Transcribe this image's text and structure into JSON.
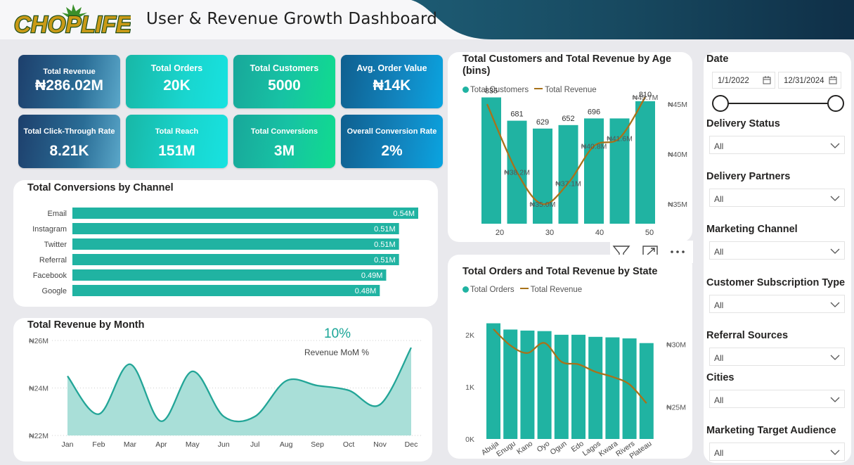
{
  "header": {
    "logo_text": "CHOPLIFE",
    "title": "User & Revenue Growth Dashboard"
  },
  "kpis": [
    {
      "label": "Total Revenue",
      "value": "₦286.02M"
    },
    {
      "label": "Total Orders",
      "value": "20K"
    },
    {
      "label": "Total Customers",
      "value": "5000"
    },
    {
      "label": "Avg. Order Value",
      "value": "₦14K"
    },
    {
      "label": "Total Click-Through Rate",
      "value": "8.21K"
    },
    {
      "label": "Total Reach",
      "value": "151M"
    },
    {
      "label": "Total Conversions",
      "value": "3M"
    },
    {
      "label": "Overall Conversion Rate",
      "value": "2%"
    }
  ],
  "colors": {
    "teal": "#20b3a2",
    "brown": "#a8721a",
    "area": "#a9dfd8",
    "area_line": "#22a597"
  },
  "chart_data": [
    {
      "type": "bar",
      "orientation": "horizontal",
      "title": "Total Conversions by Channel",
      "categories": [
        "Email",
        "Instagram",
        "Twitter",
        "Referral",
        "Facebook",
        "Google"
      ],
      "values": [
        0.54,
        0.51,
        0.51,
        0.51,
        0.49,
        0.48
      ],
      "labels": [
        "0.54M",
        "0.51M",
        "0.51M",
        "0.51M",
        "0.49M",
        "0.48M"
      ],
      "xlim": [
        0,
        0.54
      ]
    },
    {
      "type": "area",
      "title": "Total Revenue by Month",
      "x": [
        "Jan",
        "Feb",
        "Mar",
        "Apr",
        "May",
        "Jun",
        "Jul",
        "Aug",
        "Sep",
        "Oct",
        "Nov",
        "Dec"
      ],
      "values": [
        24.5,
        22.9,
        25.0,
        22.6,
        24.7,
        22.8,
        22.8,
        24.3,
        24.1,
        23.9,
        23.3,
        25.7
      ],
      "ylim": [
        22,
        26
      ],
      "yticks": [
        "₦22M",
        "₦24M",
        "₦26M"
      ],
      "annotation": {
        "value": "10%",
        "label": "Revenue MoM %"
      },
      "grid": true
    },
    {
      "type": "bar+line",
      "title": "Total Customers and Total Revenue by Age (bins)",
      "legend": [
        "Total Customers",
        "Total Revenue"
      ],
      "categories": [
        20,
        25,
        30,
        35,
        40,
        45,
        50
      ],
      "xticks": [
        "20",
        "30",
        "40",
        "50"
      ],
      "bar_values": [
        835,
        681,
        629,
        652,
        696,
        810
      ],
      "bar_labels": [
        "835",
        "681",
        "629",
        "652",
        "696",
        "",
        "810"
      ],
      "customers": [
        835,
        681,
        629,
        652,
        696,
        696,
        810
      ],
      "revenue": [
        46.8,
        38.2,
        35.0,
        37.1,
        40.8,
        41.6,
        45.7
      ],
      "revenue_labels": [
        "",
        "₦38.2M",
        "₦35.0M",
        "₦37.1M",
        "₦40.8M",
        "₦41.6M",
        "₦45.7M"
      ],
      "y2ticks": [
        "₦35M",
        "₦40M",
        "₦45M"
      ],
      "y2lim": [
        33.6,
        49.5
      ]
    },
    {
      "type": "bar+line",
      "title": "Total Orders and Total Revenue by State",
      "legend": [
        "Total Orders",
        "Total Revenue"
      ],
      "categories": [
        "Abuja",
        "Enugu",
        "Kano",
        "Oyo",
        "Ogun",
        "Edo",
        "Lagos",
        "Kwara",
        "Rivers",
        "Plateau"
      ],
      "orders": [
        2220,
        2100,
        2080,
        2070,
        2000,
        2000,
        1960,
        1950,
        1930,
        1840
      ],
      "revenue": [
        31.2,
        29.9,
        29.3,
        30.1,
        28.6,
        28.4,
        27.8,
        27.4,
        26.8,
        25.3
      ],
      "yticks": [
        "0K",
        "1K",
        "2K"
      ],
      "ylim": [
        0,
        2700
      ],
      "y2ticks": [
        "₦25M",
        "₦30M"
      ],
      "y2lim": [
        23.8,
        32.2
      ]
    }
  ],
  "filters": {
    "date": {
      "label": "Date",
      "start": "1/1/2022",
      "end": "12/31/2024"
    },
    "delivery_status": {
      "label": "Delivery Status",
      "value": "All"
    },
    "delivery_partners": {
      "label": "Delivery Partners",
      "value": "All"
    },
    "marketing_channel": {
      "label": "Marketing Channel",
      "value": "All"
    },
    "subscription_type": {
      "label": "Customer Subscription Type",
      "value": "All"
    },
    "referral_sources": {
      "label": "Referral Sources",
      "value": "All"
    },
    "cities": {
      "label": "Cities",
      "value": "All"
    },
    "target_audience": {
      "label": "Marketing Target Audience",
      "value": "All"
    }
  }
}
